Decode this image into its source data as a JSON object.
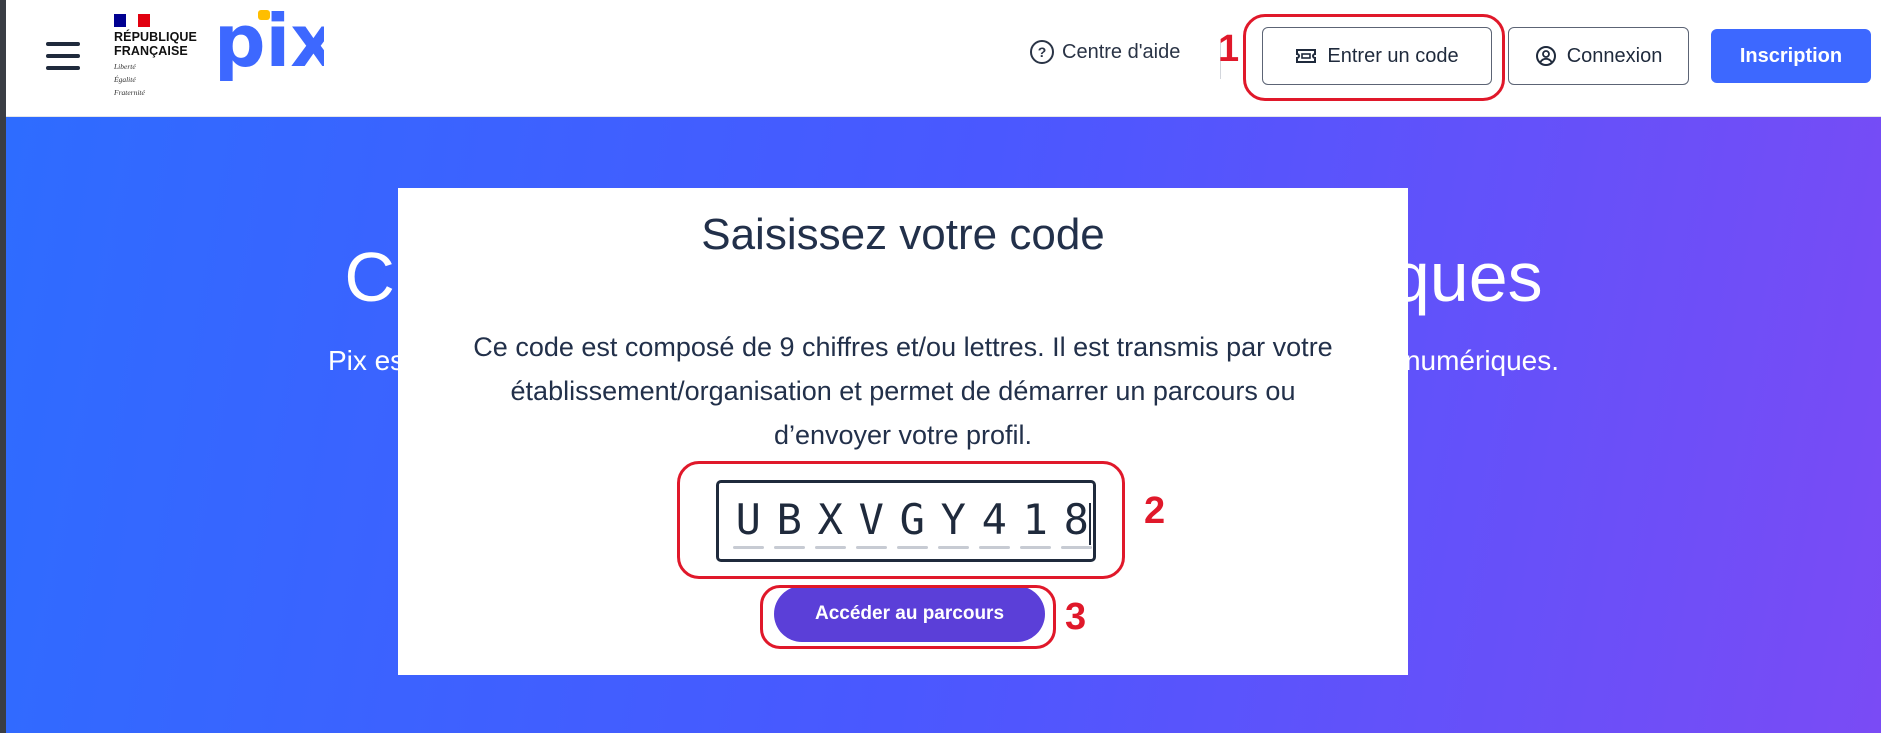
{
  "header": {
    "republique_line1": "RÉPUBLIQUE",
    "republique_line2": "FRANÇAISE",
    "motto_line1": "Liberté",
    "motto_line2": "Égalité",
    "motto_line3": "Fraternité",
    "logo_text": "pix",
    "help_label": "Centre d'aide",
    "enter_code_label": "Entrer un code",
    "login_label": "Connexion",
    "signup_label": "Inscription"
  },
  "hero": {
    "title": "Cultivez vos compétences numériques",
    "subtitle": "Pix est le service public en ligne pour évaluer, développer et certifier ses compétences numériques."
  },
  "modal": {
    "title": "Saisissez votre code",
    "description": "Ce code est composé de 9 chiffres et/ou lettres. Il est transmis par votre établissement/organisation et permet de démarrer un parcours ou d’envoyer votre profil.",
    "code_chars": [
      "U",
      "B",
      "X",
      "V",
      "G",
      "Y",
      "4",
      "1",
      "8"
    ],
    "submit_label": "Accéder au parcours"
  },
  "annotations": [
    "1",
    "2",
    "3"
  ],
  "colors": {
    "primary_blue": "#3d68ff",
    "button_purple": "#5b3fd8",
    "annotation_red": "#e0182a",
    "text_dark": "#1f2a3c"
  },
  "icons": [
    "menu-icon",
    "marianne-flag-icon",
    "help-circle-icon",
    "ticket-icon",
    "user-circle-icon"
  ]
}
